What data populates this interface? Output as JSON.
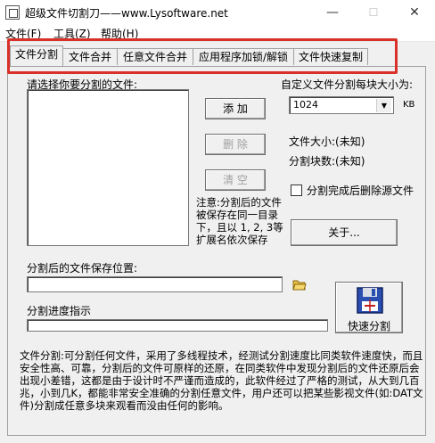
{
  "window": {
    "title": "超级文件切割刀——www.Lysoftware.net",
    "minimize": "—",
    "maximize": "☐",
    "close": "✕"
  },
  "menu": {
    "file": "文件(F)",
    "tools": "工具(Z)",
    "help": "帮助(H)"
  },
  "tabs": [
    {
      "label": "文件分割"
    },
    {
      "label": "文件合并"
    },
    {
      "label": "任意文件合并"
    },
    {
      "label": "应用程序加锁/解锁"
    },
    {
      "label": "文件快速复制"
    }
  ],
  "split": {
    "select_file_label": "请选择你要分割的文件:",
    "add_button": "添  加",
    "delete_button": "删  除",
    "clear_button": "清  空",
    "custom_size_label": "自定义文件分割每块大小为:",
    "size_value": "1024",
    "size_unit": "KB",
    "file_size_label": "文件大小:(未知)",
    "block_count_label": "分割块数:(未知)",
    "delete_source_label": "分割完成后删除源文件",
    "note": "注意:分割后的文件被保存在同一目录下，且以 1, 2, 3等扩展名依次保存",
    "about_button": "关于...",
    "save_location_label": "分割后的文件保存位置:",
    "save_location_value": "",
    "progress_label": "分割进度指示",
    "quick_split_button": "快速分割",
    "description": "文件分割:可分割任何文件，采用了多线程技术，经测试分割速度比同类软件速度快，而且安全性高、可靠，分割后的文件可原样的还原，在同类软件中发现分割后的文件还原后会出现小差错，这都是由于设计时不严谨而造成的，此软件经过了严格的测试，从大到几百兆，小到几K，都能非常安全准确的分割任意文件，用户还可以把某些影视文件(如:DAT文件)分割成任意多块来观看而没由任何的影响。"
  },
  "colors": {
    "highlight_border": "#d9302a",
    "window_bg": "#f0f0f0"
  }
}
